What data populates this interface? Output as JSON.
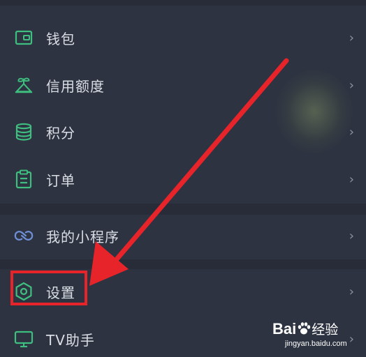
{
  "menu": {
    "items": [
      {
        "id": "wallet",
        "label": "钱包",
        "icon": "wallet-icon",
        "chevron": "›"
      },
      {
        "id": "credit",
        "label": "信用额度",
        "icon": "credit-limit-icon",
        "chevron": "›"
      },
      {
        "id": "points",
        "label": "积分",
        "icon": "coins-stack-icon",
        "chevron": "›"
      },
      {
        "id": "orders",
        "label": "订单",
        "icon": "clipboard-icon",
        "chevron": "›"
      },
      {
        "id": "mini-programs",
        "label": "我的小程序",
        "icon": "mini-program-icon",
        "chevron": "›"
      },
      {
        "id": "settings",
        "label": "设置",
        "icon": "settings-hexagon-icon",
        "chevron": "›"
      },
      {
        "id": "tv-assistant",
        "label": "TV助手",
        "icon": "tv-icon",
        "chevron": "›"
      }
    ]
  },
  "colors": {
    "background": "#2d3341",
    "icon_green": "#3fbf7f",
    "mini_program_blue": "#6f8fd8",
    "highlight_red": "#e8242b",
    "label": "#d9dde4"
  },
  "watermark": {
    "brand_prefix": "Bai",
    "brand_suffix": "经验",
    "url": "jingyan.baidu.com"
  }
}
